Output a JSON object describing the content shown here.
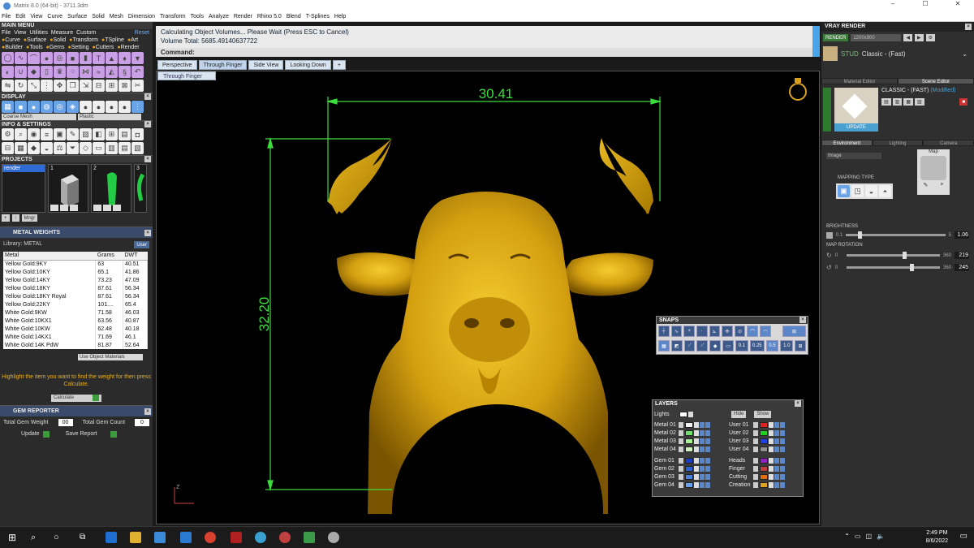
{
  "window": {
    "title": "Matrix 8.0 (64-bit) - 3711.3dm",
    "min": "–",
    "max": "☐",
    "close": "✕"
  },
  "menubar": [
    "File",
    "Edit",
    "View",
    "Curve",
    "Surface",
    "Solid",
    "Mesh",
    "Dimension",
    "Transform",
    "Tools",
    "Analyze",
    "Render",
    "Rhino 5.0",
    "Blend",
    "T-Splines",
    "Help"
  ],
  "main_menu": {
    "header": "MAIN MENU",
    "row1": [
      "File",
      "View",
      "Utilities",
      "Measure",
      "Custom"
    ],
    "reset": "Reset",
    "row2": [
      "Curve",
      "Surface",
      "Solid",
      "Transform",
      "TSpline",
      "Art"
    ],
    "row3": [
      "Builder",
      "Tools",
      "Gems",
      "Setting",
      "Cutters",
      "Render"
    ]
  },
  "display": {
    "header": "DISPLAY",
    "mesh": "Coarse Mesh",
    "material": "Plastic"
  },
  "info": {
    "header": "INFO & SETTINGS"
  },
  "projects": {
    "header": "PROJECTS",
    "list_item": "render",
    "thumb_numbers": [
      "1",
      "2",
      "3"
    ],
    "btn_mngr": "Mngr"
  },
  "metal_weights": {
    "header": "METAL WEIGHTS",
    "library_label": "Library: METAL",
    "user_label": "User",
    "columns": [
      "Metal",
      "Grams",
      "DWT"
    ],
    "rows": [
      [
        "Yellow Gold:9KY",
        "63",
        "40.51"
      ],
      [
        "Yellow Gold:10KY",
        "65.1",
        "41.86"
      ],
      [
        "Yellow Gold:14KY",
        "73.23",
        "47.09"
      ],
      [
        "Yellow Gold:18KY",
        "87.61",
        "56.34"
      ],
      [
        "Yellow Gold:18KY Royal",
        "87.61",
        "56.34"
      ],
      [
        "Yellow Gold:22KY",
        "101....",
        "65.4"
      ],
      [
        "White Gold:9KW",
        "71.58",
        "46.03"
      ],
      [
        "White Gold:10KX1",
        "63.56",
        "40.87"
      ],
      [
        "White Gold:10KW",
        "62.48",
        "40.18"
      ],
      [
        "White Gold:14KX1",
        "71.69",
        "46.1"
      ],
      [
        "White Gold:14K PdW",
        "81.87",
        "52.64"
      ]
    ],
    "use_object_materials": "Use Object Materials",
    "hint": "Highlight the item you want to find the weight for then press Calculate.",
    "calculate": "Calculate"
  },
  "gem_reporter": {
    "header": "GEM REPORTER",
    "total_weight_label": "Total Gem Weight",
    "total_weight": "00",
    "total_count_label": "Total Gem Count",
    "total_count": "0",
    "update": "Update",
    "save_report": "Save Report"
  },
  "status": {
    "line1": "Calculating Object Volumes... Please Wait (Press ESC to Cancel)",
    "line2": "Volume Total: 5685.49140637722"
  },
  "command": {
    "label": "Command:"
  },
  "viewport_tabs": [
    "Perspective",
    "Through Finger",
    "Side View",
    "Looking Down"
  ],
  "add_tab": "+",
  "active_viewport": "Through Finger",
  "dimensions": {
    "width": "30.41",
    "height": "32.20"
  },
  "axis_label": "Z",
  "snaps": {
    "header": "SNAPS",
    "values": [
      "0.1",
      "0.25",
      "0.5",
      "1.0"
    ]
  },
  "layers": {
    "header": "LAYERS",
    "lights": "Lights",
    "hide": "Hide",
    "show": "Show",
    "left": [
      {
        "name": "Metal 01",
        "color": "#f0f0f0"
      },
      {
        "name": "Metal 02",
        "color": "#6ee06e"
      },
      {
        "name": "Metal 03",
        "color": "#a8f090"
      },
      {
        "name": "Metal 04",
        "color": "#d0f0c0"
      },
      {
        "name": "Gem 01",
        "color": "#1c3cc8"
      },
      {
        "name": "Gem 02",
        "color": "#2a60d0"
      },
      {
        "name": "Gem 03",
        "color": "#4a80e0"
      },
      {
        "name": "Gem 04",
        "color": "#6aa0f0"
      }
    ],
    "right": [
      {
        "name": "User 01",
        "color": "#e02020"
      },
      {
        "name": "User 02",
        "color": "#20d020"
      },
      {
        "name": "User 03",
        "color": "#2040e0"
      },
      {
        "name": "User 04",
        "color": "#909090"
      },
      {
        "name": "Heads",
        "color": "#9020c0"
      },
      {
        "name": "Finger",
        "color": "#c04040"
      },
      {
        "name": "Cutting",
        "color": "#e07010"
      },
      {
        "name": "Creation",
        "color": "#e0a020"
      }
    ]
  },
  "vray": {
    "title": "VRAY RENDER",
    "render_btn": "RENDER",
    "resolution": "1200x900",
    "preset_label": "STUD",
    "preset": "Classic - (Fast)",
    "tabs_top": [
      "Material Editor",
      "Scene Editor"
    ],
    "material_name": "CLASSIC - (FAST)",
    "modified": "(Modified)",
    "update": "UPDATE",
    "tabs_env": [
      "Environment",
      "Lighting",
      "Camera"
    ],
    "env_type": "Image",
    "mapping_type": "MAPPING TYPE",
    "map_label": "Map",
    "brightness_label": "BRIGHTNESS",
    "brightness_min": "0.1",
    "brightness_max": "5",
    "brightness_value": "1.06",
    "map_rotation_label": "MAP ROTATION",
    "rot1_min": "0",
    "rot1_max": "360",
    "rot1_value": "219",
    "rot2_min": "0",
    "rot2_max": "360",
    "rot2_value": "245"
  },
  "taskbar": {
    "time": "2:49 PM",
    "date": "8/6/2022"
  }
}
